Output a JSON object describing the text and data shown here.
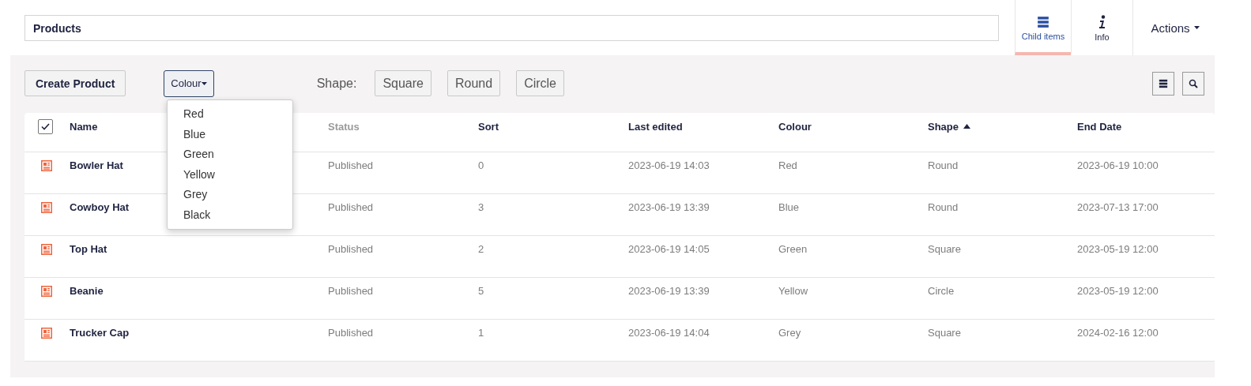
{
  "title_field": {
    "value": "Products"
  },
  "tabs": [
    {
      "label": "Child items",
      "selected": true
    },
    {
      "label": "Info",
      "selected": false
    }
  ],
  "actions": {
    "label": "Actions"
  },
  "toolbar": {
    "create_button": "Create Product",
    "colour_filter": {
      "label": "Colour",
      "expanded": true,
      "options": [
        "Red",
        "Blue",
        "Green",
        "Yellow",
        "Grey",
        "Black"
      ]
    },
    "shape_label": "Shape:",
    "shape_buttons": [
      "Square",
      "Round",
      "Circle"
    ]
  },
  "table": {
    "select_all_checked": true,
    "columns": [
      {
        "label": "Name",
        "sortable": true,
        "sorted": false
      },
      {
        "label": "Status",
        "sortable": false,
        "sorted": false
      },
      {
        "label": "Sort",
        "sortable": true,
        "sorted": false
      },
      {
        "label": "Last edited",
        "sortable": true,
        "sorted": false
      },
      {
        "label": "Colour",
        "sortable": true,
        "sorted": false
      },
      {
        "label": "Shape",
        "sortable": true,
        "sorted": true
      },
      {
        "label": "End Date",
        "sortable": true,
        "sorted": false
      }
    ],
    "rows": [
      {
        "cells": [
          "Bowler Hat",
          "Published",
          "0",
          "2023-06-19 14:03",
          "Red",
          "Round",
          "2023-06-19 10:00"
        ]
      },
      {
        "cells": [
          "Cowboy Hat",
          "Published",
          "3",
          "2023-06-19 13:39",
          "Blue",
          "Round",
          "2023-07-13 17:00"
        ]
      },
      {
        "cells": [
          "Top Hat",
          "Published",
          "2",
          "2023-06-19 14:05",
          "Green",
          "Square",
          "2023-05-19 12:00"
        ]
      },
      {
        "cells": [
          "Beanie",
          "Published",
          "5",
          "2023-06-19 13:39",
          "Yellow",
          "Circle",
          "2023-05-19 12:00"
        ]
      },
      {
        "cells": [
          "Trucker Cap",
          "Published",
          "1",
          "2023-06-19 14:04",
          "Grey",
          "Square",
          "2024-02-16 12:00"
        ]
      }
    ]
  }
}
